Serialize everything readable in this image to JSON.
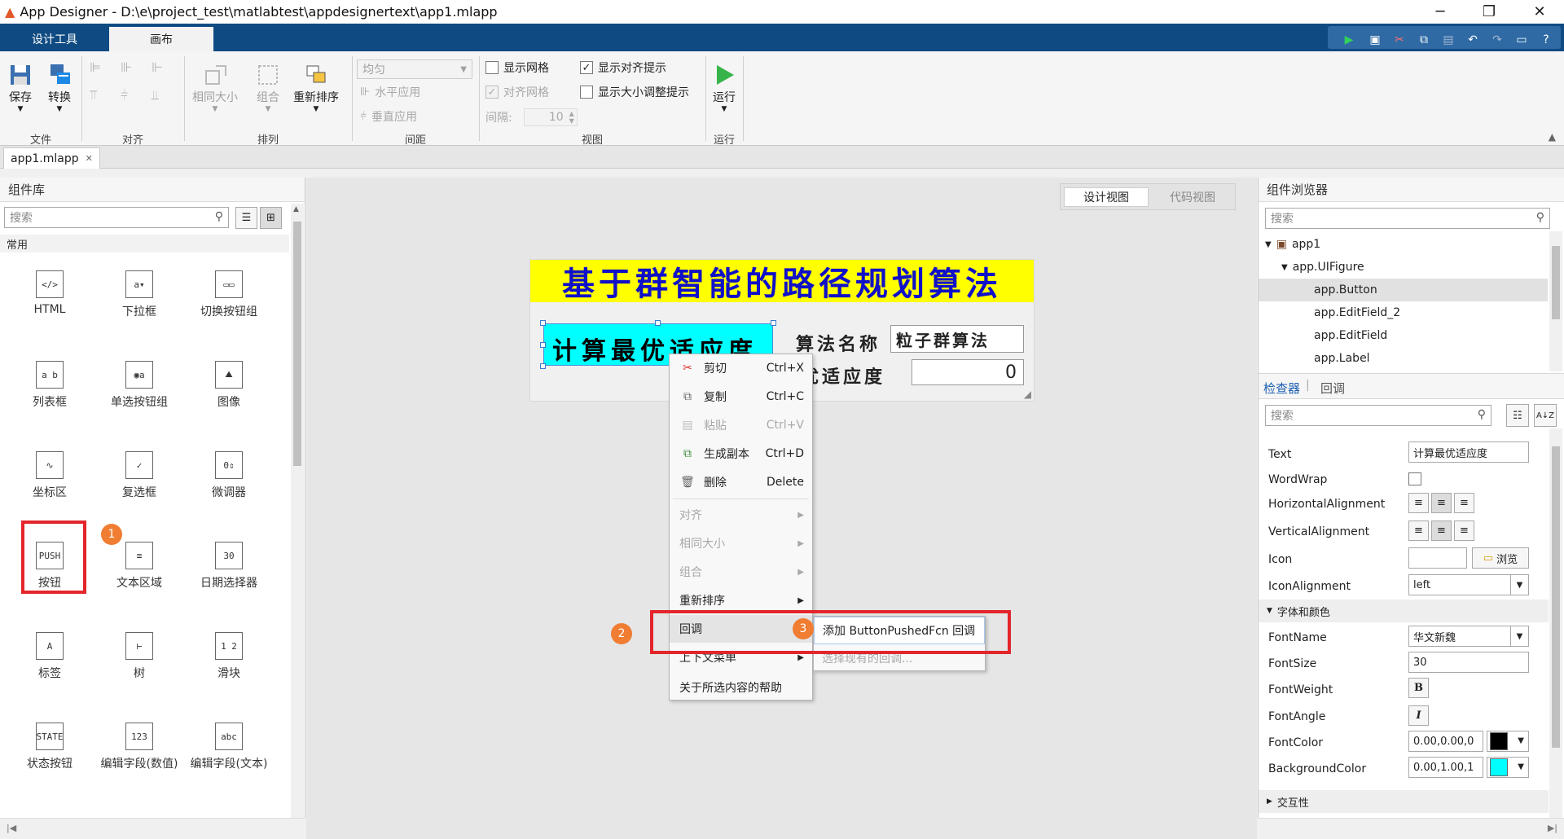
{
  "window": {
    "title": "App Designer - D:\\e\\project_test\\matlabtest\\appdesignertext\\app1.mlapp"
  },
  "ribbon": {
    "tabs": [
      "设计工具",
      "画布"
    ],
    "file": {
      "save": "保存",
      "convert": "转换",
      "label": "文件"
    },
    "align": {
      "label": "对齐"
    },
    "arrange": {
      "same_size": "相同大小",
      "group": "组合",
      "reorder": "重新排序",
      "label": "排列"
    },
    "spacing": {
      "distribute": "均匀",
      "horizontal": "水平应用",
      "vertical": "垂直应用",
      "interval_label": "间隔:",
      "interval_value": "10",
      "label": "间距"
    },
    "view": {
      "show_grid": "显示网格",
      "snap_grid": "对齐网格",
      "show_align_hints": "显示对齐提示",
      "show_resize_hints": "显示大小调整提示",
      "label": "视图"
    },
    "run": {
      "run": "运行",
      "label": "运行"
    }
  },
  "doc_tab": {
    "name": "app1.mlapp"
  },
  "library": {
    "header": "组件库",
    "search_placeholder": "搜索",
    "category": "常用",
    "components": [
      {
        "label": "HTML",
        "glyph": "</>"
      },
      {
        "label": "下拉框",
        "glyph": "a▾"
      },
      {
        "label": "切换按钮组",
        "glyph": "▭▭"
      },
      {
        "label": "列表框",
        "glyph": "a b"
      },
      {
        "label": "单选按钮组",
        "glyph": "◉a"
      },
      {
        "label": "图像",
        "glyph": "⛰"
      },
      {
        "label": "坐标区",
        "glyph": "∿"
      },
      {
        "label": "复选框",
        "glyph": "✓"
      },
      {
        "label": "微调器",
        "glyph": "0⇕"
      },
      {
        "label": "按钮",
        "glyph": "PUSH"
      },
      {
        "label": "文本区域",
        "glyph": "≡"
      },
      {
        "label": "日期选择器",
        "glyph": "30"
      },
      {
        "label": "标签",
        "glyph": "A"
      },
      {
        "label": "树",
        "glyph": "⊢"
      },
      {
        "label": "滑块",
        "glyph": "1 2"
      },
      {
        "label": "状态按钮",
        "glyph": "STATE"
      },
      {
        "label": "编辑字段(数值)",
        "glyph": "123"
      },
      {
        "label": "编辑字段(文本)",
        "glyph": "abc"
      }
    ]
  },
  "canvas": {
    "view_tabs": [
      "设计视图",
      "代码视图"
    ],
    "app": {
      "title": "基于群智能的路径规划算法",
      "button_text": "计算最优适应度",
      "algo_label": "算法名称",
      "algo_value": "粒子群算法",
      "fitness_label": "最优适应度",
      "fitness_value": "0"
    }
  },
  "context_menu": {
    "items": [
      {
        "label": "剪切",
        "shortcut": "Ctrl+X",
        "icon": "scissors-icon",
        "enabled": true
      },
      {
        "label": "复制",
        "shortcut": "Ctrl+C",
        "icon": "copy-icon",
        "enabled": true
      },
      {
        "label": "粘贴",
        "shortcut": "Ctrl+V",
        "icon": "paste-icon",
        "enabled": false
      },
      {
        "label": "生成副本",
        "shortcut": "Ctrl+D",
        "icon": "duplicate-icon",
        "enabled": true
      },
      {
        "label": "删除",
        "shortcut": "Delete",
        "icon": "trash-icon",
        "enabled": true
      },
      {
        "label": "对齐",
        "submenu": true,
        "enabled": false
      },
      {
        "label": "相同大小",
        "submenu": true,
        "enabled": false
      },
      {
        "label": "组合",
        "submenu": true,
        "enabled": false
      },
      {
        "label": "重新排序",
        "submenu": true,
        "enabled": true
      },
      {
        "label": "回调",
        "submenu": true,
        "enabled": true
      },
      {
        "label": "上下文菜单",
        "submenu": true,
        "enabled": true
      },
      {
        "label": "关于所选内容的帮助",
        "enabled": true
      }
    ],
    "submenu": [
      "添加 ButtonPushedFcn 回调",
      "选择现有的回调..."
    ]
  },
  "annotations": {
    "step1": "1",
    "step2": "2",
    "step3": "3",
    "highlight_color": "#e3262b",
    "badge_color": "#f07d32"
  },
  "browser": {
    "header": "组件浏览器",
    "search_placeholder": "搜索",
    "tree": [
      "app1",
      "app.UIFigure",
      "app.Button",
      "app.EditField_2",
      "app.EditField",
      "app.Label"
    ],
    "tabs": [
      "检查器",
      "回调"
    ],
    "inspector_search": "搜索",
    "props": {
      "text_label": "Text",
      "text_value": "计算最优适应度",
      "wordwrap_label": "WordWrap",
      "halign_label": "HorizontalAlignment",
      "valign_label": "VerticalAlignment",
      "icon_label": "Icon",
      "browse": "浏览",
      "iconalign_label": "IconAlignment",
      "iconalign_value": "left",
      "font_section": "字体和颜色",
      "fontname_label": "FontName",
      "fontname_value": "华文新魏",
      "fontsize_label": "FontSize",
      "fontsize_value": "30",
      "fontweight_label": "FontWeight",
      "fontangle_label": "FontAngle",
      "fontcolor_label": "FontColor",
      "fontcolor_value": "0.00,0.00,0",
      "bgcolor_label": "BackgroundColor",
      "bgcolor_value": "0.00,1.00,1",
      "interact_section": "交互性"
    }
  },
  "colors": {
    "ribbon_blue": "#0f4b82",
    "title_yellow": "#ffff00",
    "button_cyan": "#00ffff",
    "title_blue": "#1010c8"
  }
}
